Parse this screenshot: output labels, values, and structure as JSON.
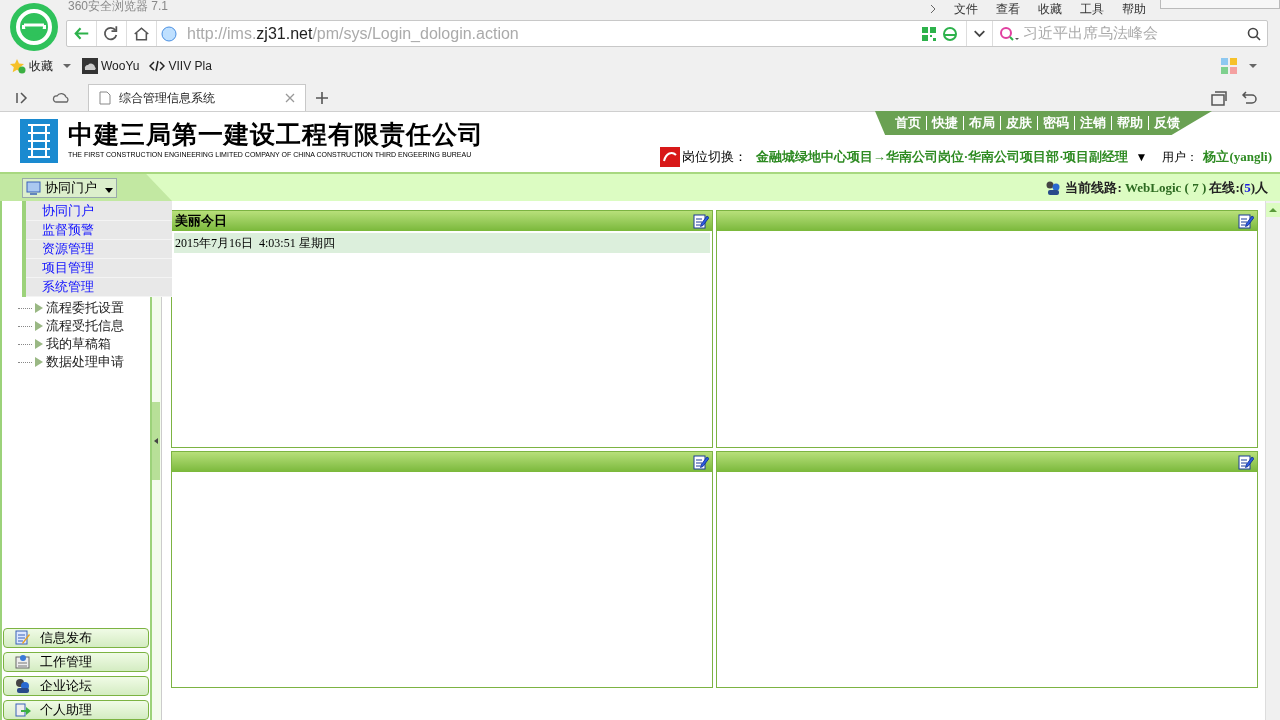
{
  "browser": {
    "title": "360安全浏览器 7.1",
    "menu": [
      "文件",
      "查看",
      "收藏",
      "工具",
      "帮助"
    ],
    "url": {
      "prefix": "http://ims.",
      "domain": "zj31.net",
      "suffix": "/pm/sys/Login_dologin.action"
    },
    "search": {
      "placeholder": "习近平出席乌法峰会"
    },
    "bookmarks": [
      {
        "kind": "favorites",
        "label": "收藏"
      },
      {
        "kind": "site",
        "label": "WooYu"
      },
      {
        "kind": "code",
        "label": "VIIV Pla"
      }
    ],
    "tabs": [
      {
        "label": "综合管理信息系统",
        "selected": true
      }
    ]
  },
  "header": {
    "company": "中建三局第一建设工程有限责任公司",
    "company_en": "THE FIRST CONSTRUCTION ENGINEERING LIMITED COMPANY OF CHINA CONSTRUCTION THIRD ENGEERING BUREAU",
    "nav": [
      "首页",
      "快捷",
      "布局",
      "皮肤",
      "密码",
      "注销",
      "帮助",
      "反馈"
    ],
    "position_label": "岗位切换：",
    "position": "金融城绿地中心项目→华南公司岗位·华南公司项目部·项目副经理",
    "position_caret": "▼",
    "user_label": "用户：",
    "user": "杨立(yangli)"
  },
  "toolbar": {
    "module": "协同门户",
    "line_label": "当前线路:",
    "line_value": "WebLogic ( 7 )",
    "online_label": "在线:(",
    "online_count": "5",
    "online_suffix": ")人"
  },
  "module_menu": [
    {
      "label": "协同门户"
    },
    {
      "label": "监督预警"
    },
    {
      "label": "资源管理"
    },
    {
      "label": "项目管理"
    },
    {
      "label": "系统管理"
    }
  ],
  "sidebar": {
    "tree": [
      {
        "label": "流程委托设置"
      },
      {
        "label": "流程受托信息"
      },
      {
        "label": "我的草稿箱"
      },
      {
        "label": "数据处理申请"
      }
    ],
    "sections": [
      {
        "kind": "publish",
        "label": "信息发布"
      },
      {
        "kind": "work",
        "label": "工作管理"
      },
      {
        "kind": "forum",
        "label": "企业论坛"
      },
      {
        "kind": "assistant",
        "label": "个人助理"
      }
    ]
  },
  "portlets": [
    {
      "title": "美丽今日",
      "editable": true,
      "rows": [
        "2015年7月16日  4:03:51 星期四"
      ]
    },
    {
      "editable": true
    },
    {
      "editable": true
    },
    {
      "editable": true
    }
  ]
}
